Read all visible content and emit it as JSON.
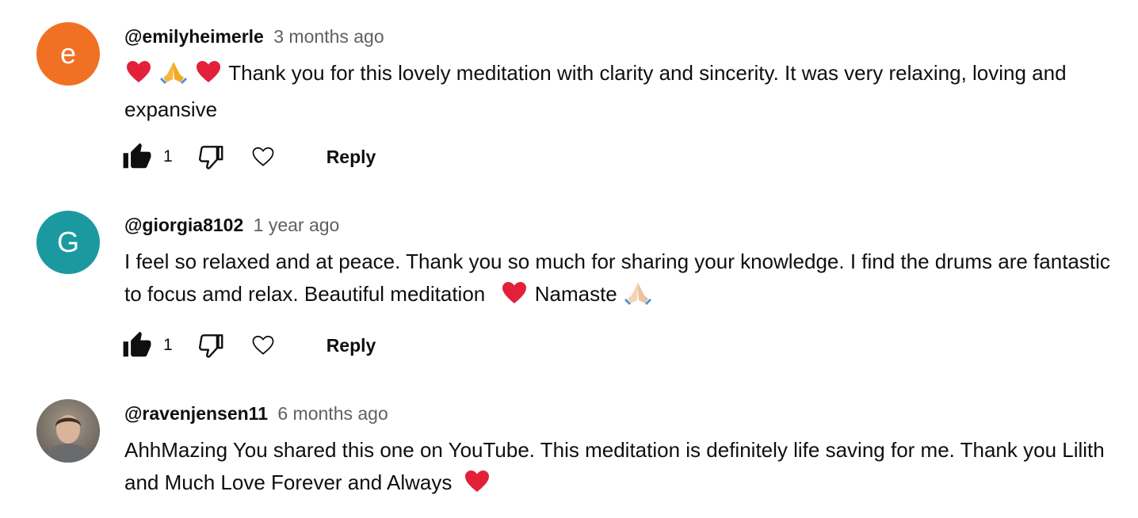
{
  "comments": [
    {
      "avatar_letter": "e",
      "avatar_color": "#f07124",
      "author": "@emilyheimerle",
      "time": "3 months ago",
      "text": "Thank you for this lovely meditation with clarity and sincerity. It was very relaxing, loving and expansive",
      "likes": "1",
      "reply_label": "Reply"
    },
    {
      "avatar_letter": "G",
      "avatar_color": "#1a9aa0",
      "author": "@giorgia8102",
      "time": "1 year ago",
      "text_part1": "I feel so relaxed and at peace. Thank you so much for sharing your knowledge. I find the drums are fantastic to focus amd relax. Beautiful meditation",
      "text_part2": "Namaste",
      "likes": "1",
      "reply_label": "Reply"
    },
    {
      "avatar_image": "profile-photo",
      "author": "@ravenjensen11",
      "time": "6 months ago",
      "text": "AhhMazing You shared this one on YouTube. This meditation is definitely life saving for me. Thank you Lilith and Much Love Forever and Always"
    }
  ],
  "icons": {
    "like": "thumbs-up-filled-icon",
    "dislike": "thumbs-down-outline-icon",
    "heart": "heart-outline-icon"
  }
}
